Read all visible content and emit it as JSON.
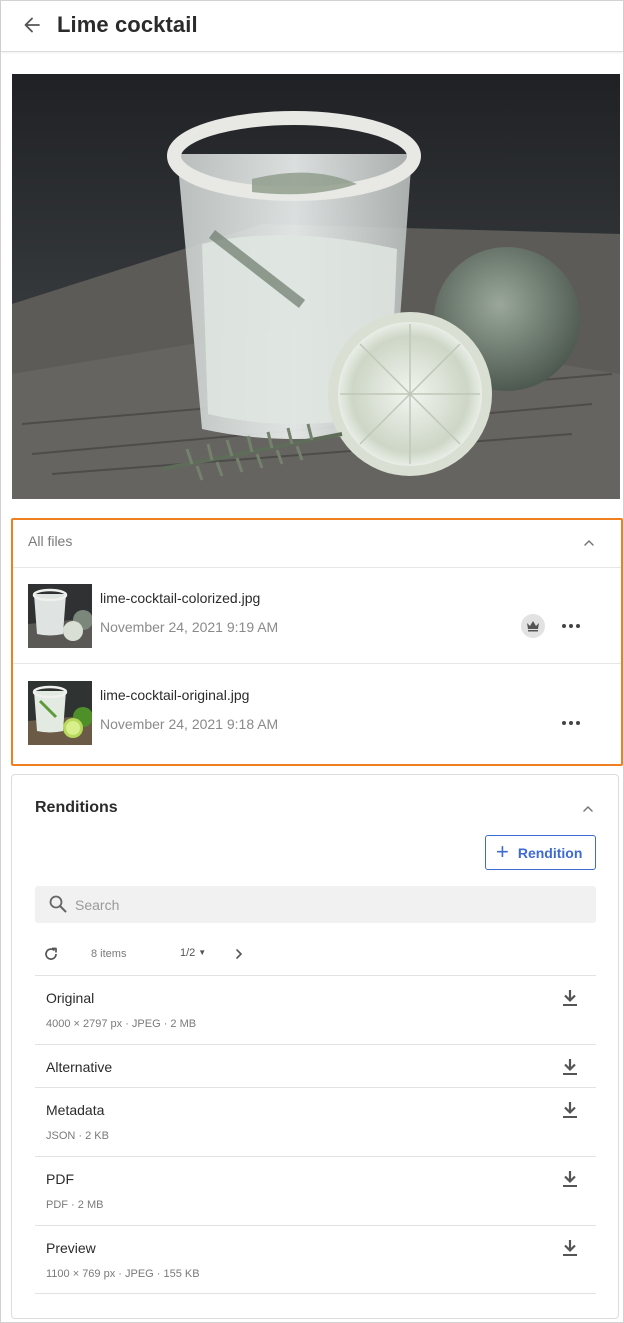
{
  "header": {
    "title": "Lime cocktail",
    "back_icon": "arrow-left-icon"
  },
  "files": {
    "heading": "All files",
    "items": [
      {
        "name": "lime-cocktail-colorized.jpg",
        "date": "November 24, 2021 9:19 AM",
        "badge_icon": "crown-icon"
      },
      {
        "name": "lime-cocktail-original.jpg",
        "date": "November 24, 2021 9:18 AM"
      }
    ]
  },
  "renditions": {
    "heading": "Renditions",
    "add_label": "Rendition",
    "search_placeholder": "Search",
    "count": "8 items",
    "page": "1/2",
    "items": [
      {
        "name": "Original",
        "meta": "4000 × 2797 px  ·  JPEG  ·  2 MB"
      },
      {
        "name": "Alternative",
        "meta": ""
      },
      {
        "name": "Metadata",
        "meta": "JSON  ·  2 KB"
      },
      {
        "name": "PDF",
        "meta": "PDF  ·  2 MB"
      },
      {
        "name": "Preview",
        "meta": "1100 × 769 px  ·  JPEG  ·  155 KB"
      }
    ]
  },
  "colors": {
    "accent": "#3d6bd1",
    "highlight_border": "#f0801f"
  }
}
